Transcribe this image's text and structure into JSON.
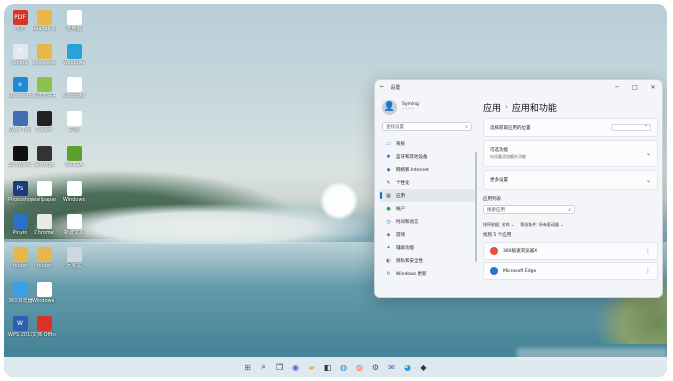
{
  "desktop": {
    "icons": [
      {
        "label": "PDF",
        "color": "#d9322b",
        "glyph": "PDF"
      },
      {
        "label": "Realtek Aud",
        "color": "#e8b74a",
        "glyph": ""
      },
      {
        "label": "此电脑",
        "color": "#ffffff",
        "glyph": ""
      },
      {
        "label": "Opera",
        "color": "#e6e6f0",
        "glyph": "O"
      },
      {
        "label": "xxxx.exe",
        "color": "#e8b74a",
        "glyph": ""
      },
      {
        "label": "Windows",
        "color": "#29a3d7",
        "glyph": ""
      },
      {
        "label": "Microsoft Edge",
        "color": "#1d8bd7",
        "glyph": "e"
      },
      {
        "label": "新建文件夹",
        "color": "#8ac34a",
        "glyph": ""
      },
      {
        "label": "Windows",
        "color": "#ffffff",
        "glyph": ""
      },
      {
        "label": "KWin Tool",
        "color": "#3e6fb4",
        "glyph": ""
      },
      {
        "label": "Steam",
        "color": "#222",
        "glyph": ""
      },
      {
        "label": "文档",
        "color": "#ffffff",
        "glyph": ""
      },
      {
        "label": "SoftWarning",
        "color": "#111",
        "glyph": ""
      },
      {
        "label": "Settings",
        "color": "#333",
        "glyph": ""
      },
      {
        "label": "NVIDIA",
        "color": "#5aa02c",
        "glyph": ""
      },
      {
        "label": "Photoshop",
        "color": "#1c3b7a",
        "glyph": "Ps"
      },
      {
        "label": "wallpaper",
        "color": "#ffffff",
        "glyph": ""
      },
      {
        "label": "Windows",
        "color": "#ffffff",
        "glyph": ""
      },
      {
        "label": "Pinyin",
        "color": "#2a6fc9",
        "glyph": ""
      },
      {
        "label": "Chrome",
        "color": "#e9e9e9",
        "glyph": ""
      },
      {
        "label": "新建文本",
        "color": "#ffffff",
        "glyph": ""
      },
      {
        "label": "folder",
        "color": "#e8b74a",
        "glyph": ""
      },
      {
        "label": "folder",
        "color": "#e8b74a",
        "glyph": ""
      },
      {
        "label": "回收站",
        "color": "#cfd6dd",
        "glyph": ""
      },
      {
        "label": "360浏览器",
        "color": "#3aa0e6",
        "glyph": ""
      },
      {
        "label": "Windows 文",
        "color": "#ffffff",
        "glyph": ""
      },
      {
        "label": "WPS 2019",
        "color": "#2b5fb4",
        "glyph": "W"
      },
      {
        "label": "文档 Office",
        "color": "#d9322b",
        "glyph": ""
      }
    ]
  },
  "taskbar": {
    "items": [
      "start",
      "search",
      "taskview",
      "chat",
      "explorer",
      "store",
      "edge",
      "chrome",
      "settings",
      "mail",
      "qq",
      "app"
    ]
  },
  "settings": {
    "title": "设置",
    "window_controls": {
      "min": "─",
      "max": "□",
      "close": "✕"
    },
    "user": {
      "name": "Syming",
      "sub": "··········"
    },
    "search_placeholder": "查找设置",
    "nav": [
      {
        "label": "系统",
        "icon": "▭",
        "color": "#2c6fd6"
      },
      {
        "label": "蓝牙和其他设备",
        "icon": "✱",
        "color": "#2c6fd6"
      },
      {
        "label": "网络和 Internet",
        "icon": "◆",
        "color": "#2c6fd6"
      },
      {
        "label": "个性化",
        "icon": "✎",
        "color": "#555"
      },
      {
        "label": "应用",
        "icon": "▦",
        "color": "#555"
      },
      {
        "label": "帐户",
        "icon": "●",
        "color": "#2a9d6d"
      },
      {
        "label": "时间和语言",
        "icon": "◷",
        "color": "#2c6fd6"
      },
      {
        "label": "游戏",
        "icon": "◈",
        "color": "#555"
      },
      {
        "label": "辅助功能",
        "icon": "✦",
        "color": "#2c6fd6"
      },
      {
        "label": "隐私和安全性",
        "icon": "◐",
        "color": "#555"
      },
      {
        "label": "Windows 更新",
        "icon": "↻",
        "color": "#2c6fd6"
      }
    ],
    "active_nav": "应用",
    "breadcrumb": {
      "parent": "应用",
      "sep": "›",
      "current": "应用和功能"
    },
    "cards": [
      {
        "label": "选择获取应用的位置",
        "sub": "",
        "type": "dropdown"
      },
      {
        "label": "可选功能",
        "sub": "向设备添加额外功能",
        "type": "chev"
      },
      {
        "label": "更多设置",
        "sub": "",
        "type": "chev"
      }
    ],
    "app_list": {
      "title": "应用列表",
      "search_placeholder": "搜索应用",
      "sort_label": "排序依据: 名称 ⌄",
      "filter_label": "筛选条件: 所有驱动器 ⌄",
      "found": "找到 5 个应用",
      "apps": [
        {
          "name": "360极速浏览器X",
          "sub": "",
          "size": "",
          "icon_color": "#e94b3c"
        },
        {
          "name": "Microsoft Edge",
          "sub": "",
          "size": "",
          "icon_color": "#2c6fd6"
        }
      ]
    }
  }
}
